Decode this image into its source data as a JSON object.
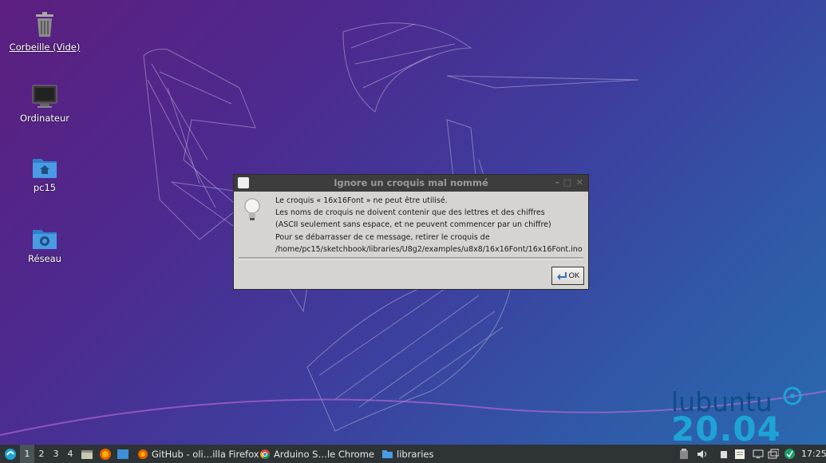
{
  "desktop": {
    "icons": [
      {
        "label": "Corbeille (Vide)"
      },
      {
        "label": "Ordinateur"
      },
      {
        "label": "pc15"
      },
      {
        "label": "Réseau"
      }
    ],
    "brand": {
      "word": "lubuntu",
      "version": "20.04"
    }
  },
  "dialog": {
    "title": "Ignore un croquis mal nommé",
    "lines": [
      "Le croquis « 16x16Font » ne peut être utilisé.",
      "Les noms de croquis ne doivent contenir que des lettres et des chiffres",
      "(ASCII seulement sans espace, et ne peuvent commencer par un chiffre)",
      "Pour se débarrasser de ce message, retirer le croquis de",
      "/home/pc15/sketchbook/libraries/U8g2/examples/u8x8/16x16Font/16x16Font.ino"
    ],
    "ok_label": "OK"
  },
  "taskbar": {
    "desktops": [
      "1",
      "2",
      "3",
      "4"
    ],
    "active_desktop": "1",
    "tasks": [
      {
        "label": "GitHub - oli…illa Firefox",
        "icon": "firefox-icon"
      },
      {
        "label": "Arduino S…le Chrome",
        "icon": "chrome-icon"
      },
      {
        "label": "libraries",
        "icon": "folder-icon"
      }
    ],
    "clock": "17:25"
  },
  "colors": {
    "dialog_bg": "#d6d4d0",
    "titlebar": "#3d3d3d",
    "taskbar": "#2e3436",
    "folder": "#3d8fd8"
  }
}
